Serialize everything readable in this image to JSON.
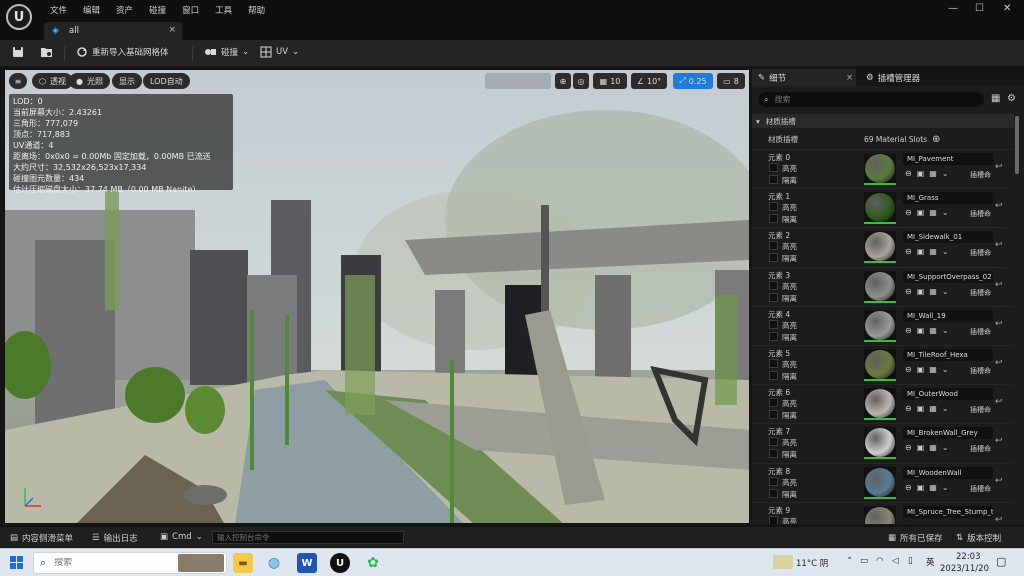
{
  "menu": [
    "文件",
    "编辑",
    "资产",
    "碰撞",
    "窗口",
    "工具",
    "帮助"
  ],
  "tab": {
    "label": "all",
    "close": "×"
  },
  "toolbar": {
    "reimport_label": "重新导入基础网格体",
    "collision_label": "碰撞",
    "uv_label": "UV"
  },
  "viewport": {
    "perspective_label": "透视",
    "lit_label": "光照",
    "show_label": "显示",
    "lod_label": "LOD自动",
    "grid_snap": "10",
    "rot_snap": "10°",
    "scale_snap": "0.25",
    "cam_speed": "8",
    "stats": [
      "LOD：0",
      "当前屏幕大小：2.43261",
      "三角形：777,079",
      "顶点：717,883",
      "UV通道：4",
      "距离场：0x0x0 = 0.00Mb 固定加载，0.00MB 已流送",
      "大约尺寸：32,532x26,523x17,334",
      "碰撞图元数量：434",
      "估计压缩磁盘大小：37.74 MB（0.00 MB Nanite）"
    ]
  },
  "panel": {
    "details_tab": "细节",
    "outliner_tab": "插槽管理器",
    "search_placeholder": "搜索",
    "section_title": "材质插槽",
    "slots_label": "材质插槽",
    "slots_count": "69 Material Slots",
    "highlight_label": "高亮",
    "isolate_label": "隔离",
    "insert_label": "插槽命",
    "elements": [
      {
        "label": "元素 0",
        "material": "MI_Pavement",
        "color": "#5c7a3c"
      },
      {
        "label": "元素 1",
        "material": "MI_Grass",
        "color": "#2f5a1f"
      },
      {
        "label": "元素 2",
        "material": "MI_Sidewalk_01",
        "color": "#a9a39a"
      },
      {
        "label": "元素 3",
        "material": "MI_SupportOverpass_02",
        "color": "#8e8e8e"
      },
      {
        "label": "元素 4",
        "material": "MI_Wall_19",
        "color": "#9a9a9a"
      },
      {
        "label": "元素 5",
        "material": "MI_TileRoof_Hexa",
        "color": "#6a7a3e"
      },
      {
        "label": "元素 6",
        "material": "MI_OuterWood",
        "color": "#bdb6ad"
      },
      {
        "label": "元素 7",
        "material": "MI_BrokenWall_Grey",
        "color": "#cfcfcf"
      },
      {
        "label": "元素 8",
        "material": "MI_WoodenWall",
        "color": "#5a7a96"
      },
      {
        "label": "元素 9",
        "material": "MI_Spruce_Tree_Stump_tu",
        "color": "#8a8470"
      }
    ]
  },
  "bottom": {
    "content_drawer": "内容侧滑菜单",
    "output_log": "输出日志",
    "cmd_label": "Cmd",
    "cmd_placeholder": "输入控制台命令",
    "save_all": "所有已保存",
    "source_control": "版本控制"
  },
  "taskbar": {
    "search_placeholder": "搜索",
    "weather": "11°C 阴",
    "ime": "英",
    "time": "22:03",
    "date": "2023/11/20"
  },
  "colors": {
    "accent_blue": "#1f7ad8",
    "slot_green": "#3bbf3b"
  }
}
